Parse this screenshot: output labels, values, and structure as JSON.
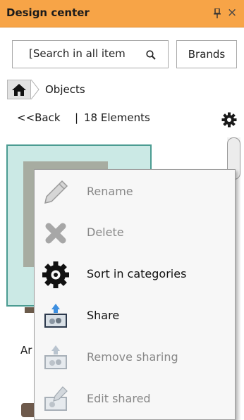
{
  "panel": {
    "title": "Design center",
    "pin_glyph": "pin-icon",
    "close_glyph": "×"
  },
  "search": {
    "value": "[Search in all item",
    "icon": "search-icon"
  },
  "brands_button": {
    "label": "Brands"
  },
  "breadcrumb": {
    "home_icon": "home-icon",
    "current": "Objects"
  },
  "navigation": {
    "back_label": "<<Back",
    "separator": "|",
    "count_label": "18 Elements",
    "settings_icon": "gear-icon"
  },
  "item": {
    "label_partial": "Ar"
  },
  "context_menu": {
    "items": [
      {
        "label": "Rename",
        "icon": "pencil-icon",
        "enabled": false
      },
      {
        "label": "Delete",
        "icon": "x-icon",
        "enabled": false
      },
      {
        "label": "Sort in categories",
        "icon": "gear-icon",
        "enabled": true
      },
      {
        "label": "Share",
        "icon": "share-folder-icon",
        "enabled": true
      },
      {
        "label": "Remove sharing",
        "icon": "unshare-folder-icon",
        "enabled": false
      },
      {
        "label": "Edit shared",
        "icon": "edit-shared-icon",
        "enabled": false
      }
    ]
  },
  "colors": {
    "title_bar": "#f7a447",
    "selected_card": "#cbe9e5",
    "selected_border": "#4b9c92",
    "menu_background": "#f7f7f7",
    "disabled_text": "#888888"
  }
}
